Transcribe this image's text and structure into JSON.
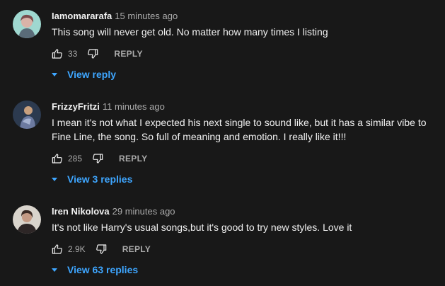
{
  "comments": [
    {
      "author": "Iamomararafa",
      "time": "15 minutes ago",
      "text": "This song will never get old. No matter how many times I listing",
      "likes": "33",
      "reply_label": "REPLY",
      "view_replies": "View reply"
    },
    {
      "author": "FrizzyFritzi",
      "time": "11 minutes ago",
      "text": "I mean it's not what I expected his next single to sound like, but it has a similar vibe to Fine Line, the song. So full of meaning and emotion. I really like it!!!",
      "likes": "285",
      "reply_label": "REPLY",
      "view_replies": "View 3 replies"
    },
    {
      "author": "Iren Nikolova",
      "time": "29 minutes ago",
      "text": "It's not like Harry's usual songs,but it's good to try new styles. Love it",
      "likes": "2.9K",
      "reply_label": "REPLY",
      "view_replies": "View 63 replies"
    }
  ],
  "colors": {
    "background": "#181818",
    "text": "#f1f1f1",
    "secondary": "#aaaaaa",
    "link": "#3ea6ff"
  },
  "icons": {
    "like": "thumb-up-icon",
    "dislike": "thumb-down-icon",
    "expand": "caret-down-icon"
  }
}
